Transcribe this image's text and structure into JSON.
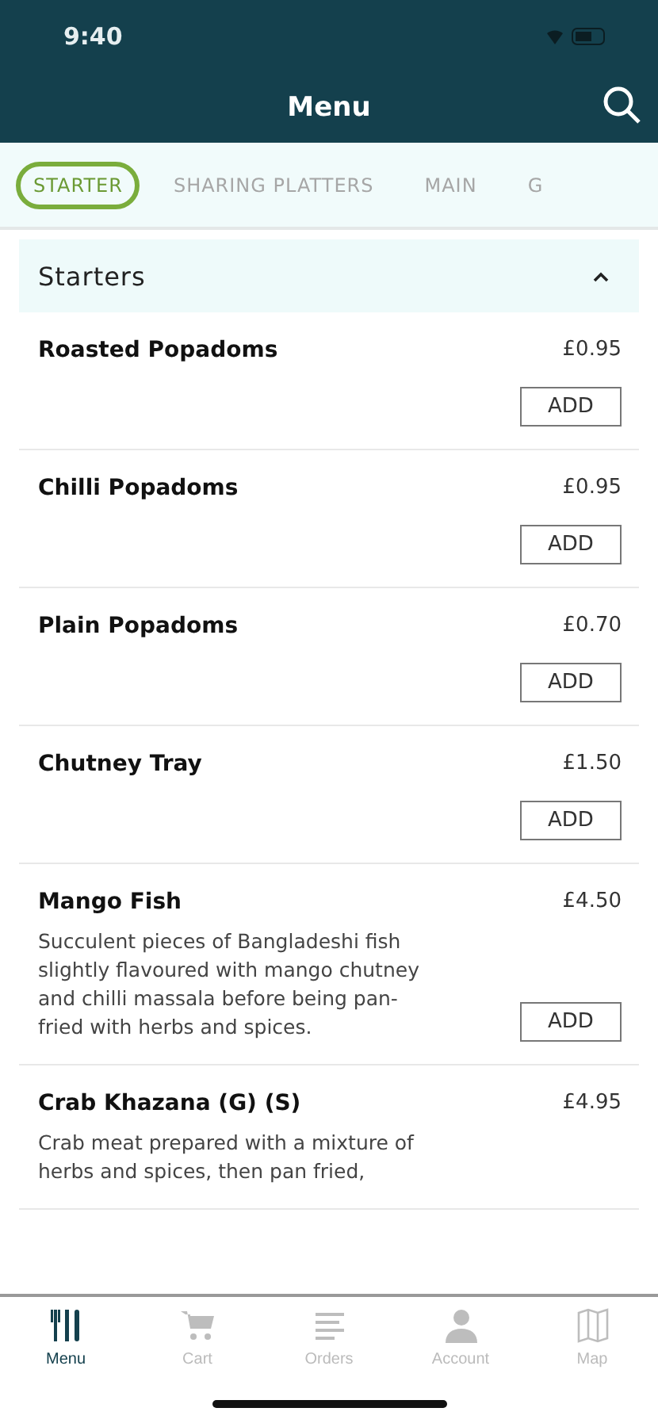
{
  "status_bar": {
    "time": "9:40"
  },
  "header": {
    "title": "Menu"
  },
  "tabs": [
    {
      "label": "STARTER",
      "selected": true
    },
    {
      "label": "SHARING PLATTERS",
      "selected": false
    },
    {
      "label": "MAIN",
      "selected": false
    },
    {
      "label": "G",
      "selected": false
    }
  ],
  "section": {
    "title": "Starters",
    "expanded": true
  },
  "items": [
    {
      "name": "Roasted Popadoms",
      "price": "£0.95",
      "button": "ADD"
    },
    {
      "name": "Chilli Popadoms",
      "price": "£0.95",
      "button": "ADD"
    },
    {
      "name": "Plain Popadoms",
      "price": "£0.70",
      "button": "ADD"
    },
    {
      "name": "Chutney Tray",
      "price": "£1.50",
      "button": "ADD"
    },
    {
      "name": "Mango Fish",
      "price": "£4.50",
      "description": "Succulent pieces of Bangladeshi fish slightly flavoured with mango chutney and chilli massala before being pan-fried with herbs and spices.",
      "button": "ADD"
    },
    {
      "name": "Crab Khazana (G) (S)",
      "price": "£4.95",
      "description": "Crab meat prepared with a mixture of herbs and spices, then pan fried,"
    }
  ],
  "nav": [
    {
      "label": "Menu",
      "selected": true
    },
    {
      "label": "Cart",
      "selected": false
    },
    {
      "label": "Orders",
      "selected": false
    },
    {
      "label": "Account",
      "selected": false
    },
    {
      "label": "Map",
      "selected": false
    }
  ]
}
